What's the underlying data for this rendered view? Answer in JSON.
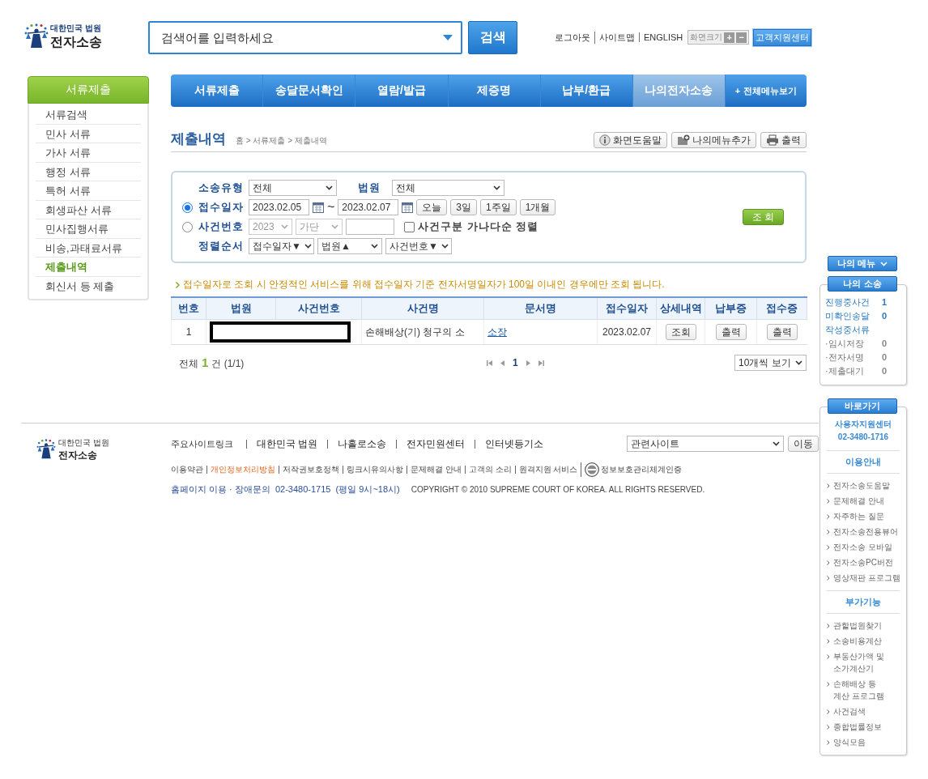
{
  "header": {
    "logo": {
      "subtitle": "대한민국 법원",
      "title": "전자소송"
    },
    "search": {
      "placeholder": "검색어를 입력하세요"
    },
    "search_button": "검색",
    "util_links": [
      "로그아웃",
      "사이트맵",
      "ENGLISH"
    ],
    "font_size": {
      "label": "화면크기",
      "buttons": [
        "+",
        "−"
      ]
    },
    "support_button": "고객지원센터"
  },
  "sidebar": {
    "title": "서류제출",
    "items": [
      {
        "label": "서류검색",
        "selected": false
      },
      {
        "label": "민사 서류",
        "selected": false
      },
      {
        "label": "가사 서류",
        "selected": false
      },
      {
        "label": "행정 서류",
        "selected": false
      },
      {
        "label": "특허 서류",
        "selected": false
      },
      {
        "label": "회생파산 서류",
        "selected": false
      },
      {
        "label": "민사집행서류",
        "selected": false
      },
      {
        "label": "비송,과태료서류",
        "selected": false
      },
      {
        "label": "제출내역",
        "selected": true
      },
      {
        "label": "회신서 등 제출",
        "selected": false
      }
    ]
  },
  "nav": {
    "items": [
      {
        "label": "서류제출",
        "selected": false
      },
      {
        "label": "송달문서확인",
        "selected": false
      },
      {
        "label": "열람/발급",
        "selected": false
      },
      {
        "label": "제증명",
        "selected": false
      },
      {
        "label": "납부/환급",
        "selected": false
      },
      {
        "label": "나의전자소송",
        "selected": true
      }
    ],
    "all_menu": {
      "icon": "+",
      "label": "전체메뉴보기"
    }
  },
  "page": {
    "title": "제출내역",
    "breadcrumb": "홈 > 서류제출 > 제출내역",
    "tools": [
      "화면도움말",
      "나의메뉴추가",
      "출력"
    ]
  },
  "filter": {
    "case_type": {
      "label": "소송유형",
      "value": "전체"
    },
    "court": {
      "label": "법원",
      "value": "전체"
    },
    "modes": [
      {
        "label": "접수일자",
        "selected": true
      },
      {
        "label": "사건번호",
        "selected": false
      }
    ],
    "date_from": "2023.02.05",
    "date_separator": "~",
    "date_to": "2023.02.07",
    "quick_ranges": [
      "오늘",
      "3일",
      "1주일",
      "1개월"
    ],
    "case_number": {
      "year": "2023",
      "kind": "가단",
      "disabled": true
    },
    "sort_checkbox": {
      "label": "사건구분 가나다순 정렬",
      "checked": false
    },
    "sort": {
      "label": "정렬순서",
      "values": [
        "접수일자▼",
        "법원▲",
        "사건번호▼"
      ]
    },
    "search_button": "조 회"
  },
  "notice": "접수일자로 조회 시 안정적인 서비스를 위해 접수일자 기준 전자서명일자가 100일 이내인 경우에만 조회 됩니다.",
  "table": {
    "columns": [
      "번호",
      "법원",
      "사건번호",
      "사건명",
      "문서명",
      "접수일자",
      "상세내역",
      "납부증",
      "접수증"
    ],
    "rows": [
      {
        "number": "1",
        "redacted": true,
        "case_name": "손해배상(기) 청구의 소",
        "document": "소장",
        "date": "2023.02.07",
        "detail": "조회",
        "payment": "출력",
        "receipt": "출력"
      }
    ]
  },
  "pagination": {
    "total_prefix": "전체",
    "total": "1",
    "total_suffix": "건 (1/1)",
    "pages": [
      {
        "label": "1",
        "selected": true
      }
    ],
    "page_size": "10개씩 보기"
  },
  "footer": {
    "logo": {
      "subtitle": "대한민국 법원",
      "title": "전자소송"
    },
    "sites_label": "주요사이트링크",
    "sites": [
      "대한민국 법원",
      "나홀로소송",
      "전자민원센터",
      "인터넷등기소"
    ],
    "related_sites": "관련사이트",
    "go_button": "이동",
    "links": [
      {
        "label": "이용약관",
        "emphasized": false
      },
      {
        "label": "개인정보처리방침",
        "emphasized": true
      },
      {
        "label": "저작권보호정책",
        "emphasized": false
      },
      {
        "label": "링크시유의사항",
        "emphasized": false
      },
      {
        "label": "문제해결 안내",
        "emphasized": false
      },
      {
        "label": "고객의 소리",
        "emphasized": false
      },
      {
        "label": "원격지원 서비스",
        "emphasized": false
      }
    ],
    "certification": "정보보호관리체계인증",
    "contact": "홈페이지 이용 · 장애문의  02-3480-1715  (평일 9시~18시)",
    "copyright": "COPYRIGHT © 2010 SUPREME COURT OF KOREA. ALL RIGHTS RESERVED."
  },
  "quick_menu": {
    "my_menu": "나의 메뉴",
    "my_case": {
      "title": "나의 소송",
      "rows": [
        {
          "label": "진행중사건",
          "count": "1"
        },
        {
          "label": "미확인송달",
          "count": "0"
        }
      ],
      "subtitle": "작성중서류",
      "subrows": [
        {
          "label": "·임시저장",
          "count": "0"
        },
        {
          "label": "·전자서명",
          "count": "0"
        },
        {
          "label": "·제출대기",
          "count": "0"
        }
      ]
    },
    "shortcuts": {
      "title": "바로가기",
      "center": "사용자지원센터",
      "phone": "02-3480-1716",
      "sections": [
        {
          "title": "이용안내",
          "items": [
            "전자소송도움말",
            "문제해결 안내",
            "자주하는 질문",
            "전자소송전용뷰어",
            "전자소송 모바일",
            "전자소송PC버전",
            "영상재판 프로그램"
          ]
        },
        {
          "title": "부가기능",
          "items": [
            "관할법원찾기",
            "소송비용계산",
            "부동산가액 및\n소가계산기",
            "손해배상 등\n계산 프로그램",
            "사건검색",
            "종합법률정보",
            "양식모음"
          ]
        }
      ]
    }
  }
}
